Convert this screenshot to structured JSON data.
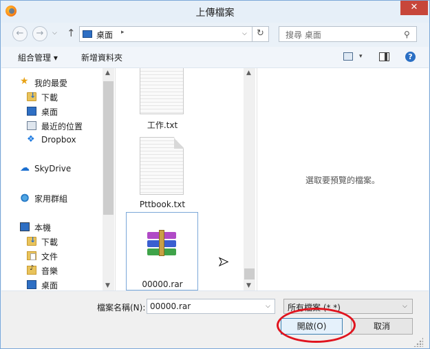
{
  "window": {
    "title": "上傳檔案",
    "close_glyph": "✕"
  },
  "address": {
    "back_glyph": "←",
    "forward_glyph": "→",
    "up_glyph": "↑",
    "location": "桌面",
    "path_arrow_glyph": "▸",
    "dropdown_glyph": "⌵",
    "refresh_glyph": "↻"
  },
  "search": {
    "placeholder": "搜尋 桌面",
    "icon_glyph": "⚲"
  },
  "toolbar": {
    "organize_label": "組合管理 ▾",
    "new_folder_label": "新增資料夾",
    "view_dropdown_glyph": "▾",
    "help_glyph": "?"
  },
  "nav": {
    "items": [
      {
        "label": "我的最愛",
        "icon": "star-icon"
      },
      {
        "label": "下載",
        "icon": "downloads-folder-icon"
      },
      {
        "label": "桌面",
        "icon": "desktop-icon"
      },
      {
        "label": "最近的位置",
        "icon": "recent-places-icon"
      },
      {
        "label": "Dropbox",
        "icon": "dropbox-icon"
      },
      {
        "label": "SkyDrive",
        "icon": "skydrive-icon"
      },
      {
        "label": "家用群組",
        "icon": "homegroup-icon"
      },
      {
        "label": "本機",
        "icon": "computer-icon"
      },
      {
        "label": "下載",
        "icon": "downloads-folder-icon"
      },
      {
        "label": "文件",
        "icon": "documents-folder-icon"
      },
      {
        "label": "音樂",
        "icon": "music-folder-icon"
      },
      {
        "label": "桌面",
        "icon": "desktop-icon"
      }
    ]
  },
  "files": [
    {
      "name": "工作.txt",
      "icon": "text-file-icon"
    },
    {
      "name": "Pttbook.txt",
      "icon": "text-file-icon"
    },
    {
      "name": "00000.rar",
      "icon": "winrar-archive-icon",
      "selected": true
    }
  ],
  "preview": {
    "message": "選取要預覽的檔案。"
  },
  "bottom": {
    "filename_label": "檔案名稱(N):",
    "filename_value": "00000.rar",
    "filter_value": "所有檔案 (*.*)",
    "open_label": "開啟(O)",
    "cancel_label": "取消",
    "dropdown_glyph": "⌵"
  },
  "scroll": {
    "up_glyph": "▲",
    "down_glyph": "▼"
  },
  "colors": {
    "highlight_ellipse": "#e0141e",
    "selection_border": "#7aa7d8",
    "accent": "#2e6fc4"
  }
}
